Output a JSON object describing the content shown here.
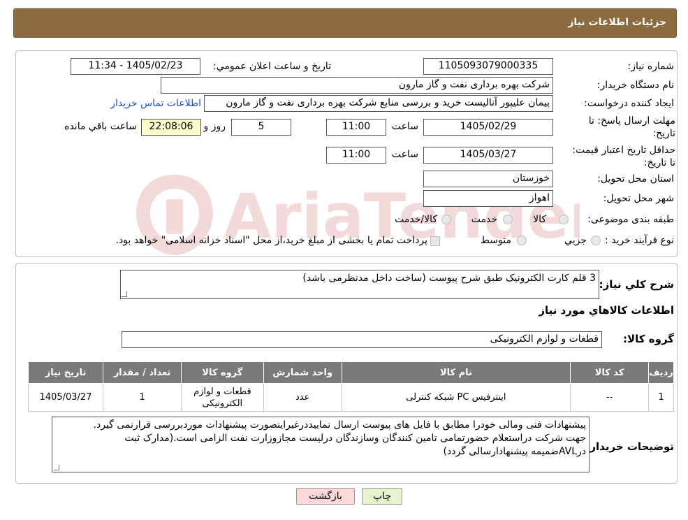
{
  "header": {
    "title": "جزئیات اطلاعات نیاز"
  },
  "form": {
    "need_number_label": "شماره نیاز:",
    "need_number": "1105093079000335",
    "announce_label": "تاریخ و ساعت اعلان عمومي:",
    "announce_value": "1405/02/23 - 11:34",
    "buyer_org_label": "نام دستگاه خريدار:",
    "buyer_org": "شرکت بهره برداری نفت و گاز مارون",
    "creator_label": "ايجاد کننده درخواست:",
    "creator": "پیمان علیپور آنالیست خرید و بررسی منابع شرکت بهره برداری نفت و گاز مارون",
    "contact_link": "اطلاعات تماس خريدار",
    "deadline_label": "مهلت ارسال پاسخ: تا تاريخ:",
    "deadline_date": "1405/02/29",
    "time_label": "ساعت",
    "deadline_time": "11:00",
    "days": "5",
    "days_label": "روز و",
    "remaining": "22:08:06",
    "remaining_label": "ساعت باقي مانده",
    "validity_label": "حداقل تاريخ اعتبار قيمت: تا تاريخ:",
    "validity_date": "1405/03/27",
    "validity_time": "11:00",
    "province_label": "استان محل تحويل:",
    "province": "خوزستان",
    "city_label": "شهر محل تحويل:",
    "city": "اهواز",
    "category_label": "طبقه بندی موضوعی:",
    "category_options": [
      "کالا",
      "خدمت",
      "کالا/خدمت"
    ],
    "process_label": "نوع فرآيند خريد :",
    "process_options": [
      "جزيي",
      "متوسط"
    ],
    "process_note": "پرداخت تمام يا بخشی از مبلغ خريد،از محل \"اسناد خزانه اسلامی\" خواهد بود."
  },
  "watermark": {
    "text": "AriaTender.neT"
  },
  "details": {
    "summary_label": "شرح کلي نياز:",
    "summary": "3 قلم کارت الکترونیک طبق شرح پیوست (ساخت داخل مدنظرمی باشد)",
    "goods_info_title": "اطلاعات کالاهاي مورد نياز",
    "group_label": "گروه کالا:",
    "group": "قطعات و لوازم الکترونیکی",
    "table": {
      "headers": [
        "رديف",
        "کد کالا",
        "نام کالا",
        "واحد شمارش",
        "گروه کالا",
        "تعداد / مقدار",
        "تاريخ نياز"
      ],
      "rows": [
        [
          "1",
          "--",
          "اینترفیس PC شبکه کنترلی",
          "عدد",
          "قطعات و لوازم الکترونیکی",
          "1",
          "1405/03/27"
        ]
      ]
    },
    "buyer_notes_label": "توضيحات خريدار:",
    "buyer_notes": [
      "پیشنهادات فنی ومالی خودرا  مطابق با فایل های پیوست ارسال نمایيددرغیراینصورت پیشنهادات موردبررسی قرارنمی گیرد.",
      "جهت شرکت دراستعلام حضورتمامی تامین کنندگان وسازندگان درلیست مجازوزارت نفت الزامی است.(مدارک ثبت",
      "درAVLضمیمه پیشنهادارسالی گردد)"
    ]
  },
  "buttons": {
    "print": "چاپ",
    "back": "بازگشت"
  },
  "colors": {
    "header_bg": "#8b6b3f",
    "table_header_bg": "#7a7a7a",
    "remaining_bg": "#ffffcc",
    "print_bg": "#e6f5d0",
    "back_bg": "#fbd9d9",
    "link": "#1a4fd6"
  }
}
